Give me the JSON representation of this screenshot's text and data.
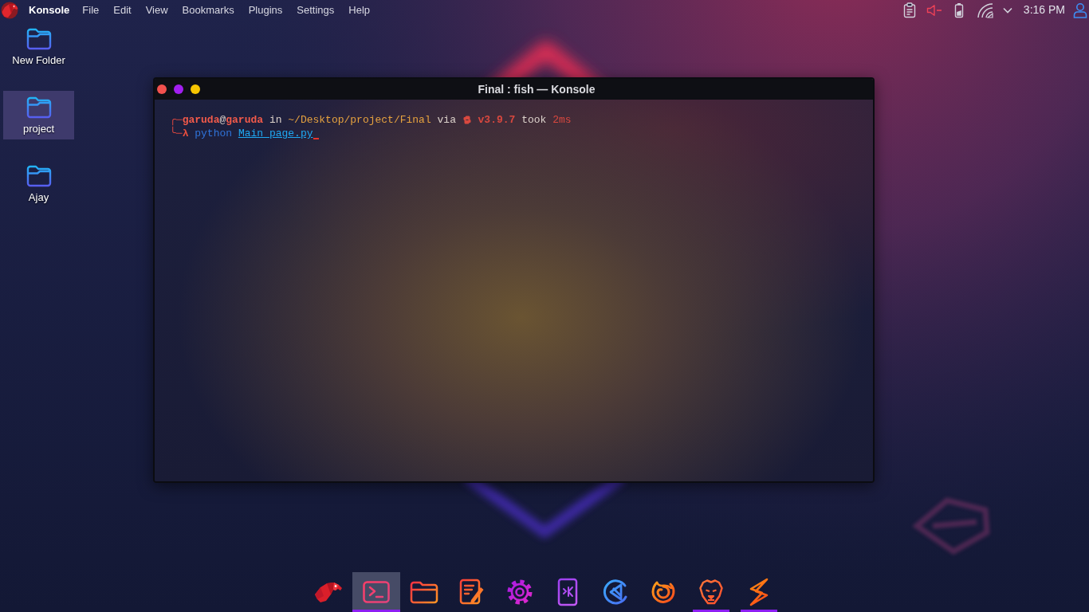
{
  "top_panel": {
    "app_name": "Konsole",
    "menu": [
      "File",
      "Edit",
      "View",
      "Bookmarks",
      "Plugins",
      "Settings",
      "Help"
    ],
    "tray": {
      "volume_muted": true,
      "clock": "3:16 PM"
    }
  },
  "desktop_icons": [
    {
      "label": "New Folder",
      "selected": false
    },
    {
      "label": "project",
      "selected": true
    },
    {
      "label": "Ajay",
      "selected": false
    }
  ],
  "terminal": {
    "title": "Final : fish — Konsole",
    "cursor": true,
    "lines": [
      {
        "segments": [
          {
            "kind": "frame",
            "text": "╭─"
          },
          {
            "kind": "user",
            "text": "garuda"
          },
          {
            "kind": "plain",
            "text": "@"
          },
          {
            "kind": "user",
            "text": "garuda"
          },
          {
            "kind": "plain",
            "text": " in "
          },
          {
            "kind": "path",
            "text": "~/Desktop/project/Final"
          },
          {
            "kind": "plain",
            "text": " via "
          },
          {
            "kind": "icon"
          },
          {
            "kind": "version",
            "text": " v3.9.7"
          },
          {
            "kind": "plain",
            "text": " took "
          },
          {
            "kind": "duration",
            "text": "2ms"
          }
        ]
      },
      {
        "segments": [
          {
            "kind": "frame",
            "text": "╰─"
          },
          {
            "kind": "symbol",
            "text": "λ"
          },
          {
            "kind": "command",
            "text": " python "
          },
          {
            "kind": "argument",
            "text": "Main_page.py"
          }
        ]
      }
    ]
  },
  "dock": [
    {
      "kind": "eagle",
      "selected": false,
      "running": false
    },
    {
      "kind": "terminal",
      "selected": true,
      "running": true
    },
    {
      "kind": "folder",
      "selected": false,
      "running": false
    },
    {
      "kind": "notes",
      "selected": false,
      "running": false
    },
    {
      "kind": "gear",
      "selected": false,
      "running": false
    },
    {
      "kind": "phone",
      "selected": false,
      "running": false
    },
    {
      "kind": "code",
      "selected": false,
      "running": false
    },
    {
      "kind": "flame",
      "selected": false,
      "running": false
    },
    {
      "kind": "lion",
      "selected": false,
      "running": true
    },
    {
      "kind": "bolt",
      "selected": false,
      "running": true
    }
  ]
}
